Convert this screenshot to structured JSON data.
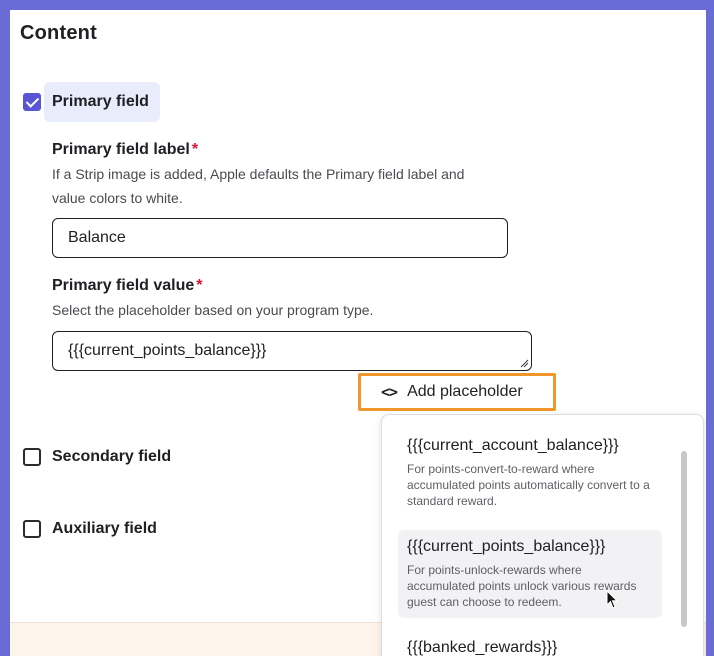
{
  "section": {
    "title": "Content"
  },
  "primary": {
    "checkbox_label": "Primary field",
    "checked": true,
    "label_field": {
      "title": "Primary field label",
      "required_mark": "*",
      "helper": "If a Strip image is added, Apple defaults the Primary field label and value colors to white.",
      "value": "Balance"
    },
    "value_field": {
      "title": "Primary field value",
      "required_mark": "*",
      "helper": "Select the placeholder based on your program type.",
      "value": "{{{current_points_balance}}}"
    },
    "add_placeholder_label": "Add placeholder",
    "add_placeholder_icon": "code-icon"
  },
  "secondary": {
    "checkbox_label": "Secondary field",
    "checked": false
  },
  "auxiliary": {
    "checkbox_label": "Auxiliary field",
    "checked": false
  },
  "placeholder_menu": {
    "options": [
      {
        "token": "{{{current_account_balance}}}",
        "description": "For points-convert-to-reward where accumulated points automatically convert to a standard reward."
      },
      {
        "token": "{{{current_points_balance}}}",
        "description": "For points-unlock-rewards where accumulated points unlock various rewards guest can choose to redeem."
      },
      {
        "token": "{{{banked_rewards}}}",
        "description": ""
      }
    ]
  },
  "colors": {
    "accent": "#5a55d4",
    "highlight_border": "#f0962a",
    "required": "#d8143a"
  }
}
